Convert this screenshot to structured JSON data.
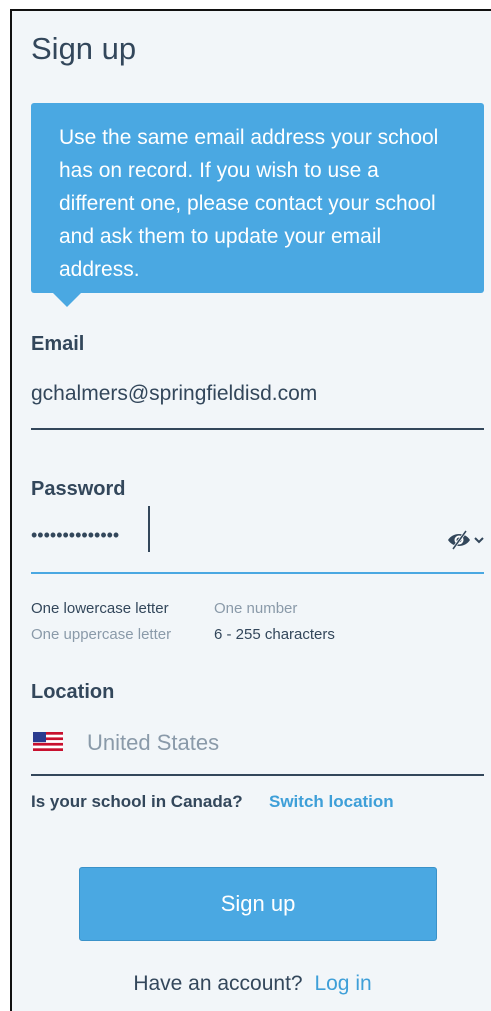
{
  "page": {
    "title": "Sign up"
  },
  "tooltip": {
    "text": "Use the same email address your school has on record. If you wish to use a different one, please contact your school and ask them to update your email address."
  },
  "email": {
    "label": "Email",
    "value": "gchalmers@springfieldisd.com"
  },
  "password": {
    "label": "Password",
    "masked_value": "••••••••••••••",
    "toggle_icon": "eye-hidden-icon",
    "requirements": [
      {
        "text": "One lowercase letter",
        "met": true
      },
      {
        "text": "One number",
        "met": false
      },
      {
        "text": "One uppercase letter",
        "met": false
      },
      {
        "text": "6 - 255 characters",
        "met": true
      }
    ]
  },
  "location": {
    "label": "Location",
    "value": "United States",
    "flag_icon": "us-flag-icon"
  },
  "canada": {
    "question": "Is your school in Canada?",
    "link_label": "Switch location"
  },
  "actions": {
    "signup_label": "Sign up",
    "have_account_text": "Have an account?",
    "login_label": "Log in"
  },
  "colors": {
    "accent": "#4aa8e2",
    "text": "#33475b",
    "muted": "#8a9aa9",
    "background": "#f2f6f9"
  }
}
